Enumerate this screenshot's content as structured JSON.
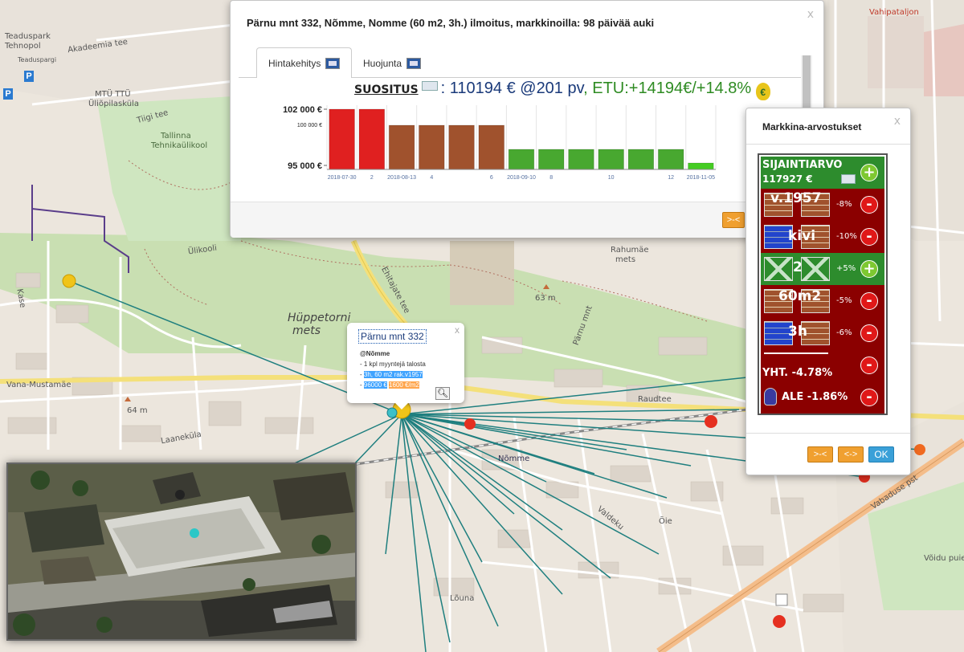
{
  "main_dialog": {
    "title": "Pärnu mnt 332, Nõmme, Nomme (60 m2, 3h.) ilmoitus, markkinoilla: 98 päivää auki",
    "close": "x",
    "tabs": [
      {
        "label": "Hintakehitys",
        "icon": "chart-icon"
      },
      {
        "label": "Huojunta",
        "icon": "chart-icon"
      }
    ],
    "recommendation": {
      "label": "SUOSITUS",
      "value": ": 110194 € @201 pv",
      "benefit": ", ETU:+14194€/+14.8%",
      "bag": "€"
    },
    "button_collapse": ">-<"
  },
  "chart_data": {
    "type": "bar",
    "title": "",
    "xlabel": "",
    "ylabel": "",
    "ylim": [
      94500,
      102500
    ],
    "y_ticks": [
      {
        "value": 102000,
        "label": "102 000 €",
        "major": true
      },
      {
        "value": 100000,
        "label": "100 000 €",
        "major": false
      },
      {
        "value": 95000,
        "label": "95 000 €",
        "major": true
      }
    ],
    "values": [
      102000,
      102000,
      100000,
      100000,
      100000,
      100000,
      97000,
      97000,
      97000,
      97000,
      97000,
      97000,
      96000
    ],
    "colors": [
      "#e02020",
      "#e02020",
      "#a0522d",
      "#a0522d",
      "#a0522d",
      "#a0522d",
      "#48a830",
      "#48a830",
      "#48a830",
      "#48a830",
      "#48a830",
      "#48a830",
      "#44cc22"
    ],
    "x_tick_labels": [
      "2018-07-30",
      "2",
      "2018-08-13",
      "4",
      "",
      "6",
      "2018-09-10",
      "8",
      "",
      "10",
      "",
      "12",
      "2018-11-05"
    ]
  },
  "side_dialog": {
    "title": "Markkina-arvostukset",
    "close": "x",
    "location": {
      "label": "SIJAINTIARVO",
      "value": "117927 €"
    },
    "rows": [
      {
        "text": "v.1957",
        "pct": "-8%",
        "sign": "-"
      },
      {
        "text": "kivi",
        "pct": "-10%",
        "sign": "-"
      },
      {
        "text": "2",
        "pct": "+5%",
        "sign": "+"
      },
      {
        "text": "60m2",
        "pct": "-5%",
        "sign": "-"
      },
      {
        "text": "3h",
        "pct": "-6%",
        "sign": "-"
      }
    ],
    "total": "YHT. -4.78%",
    "discount": "ALE -1.86%",
    "buttons": {
      "collapse": ">-<",
      "expand": "<->",
      "ok": "OK"
    }
  },
  "popup": {
    "title": "Pärnu mnt 332",
    "close": "x",
    "district": "@Nõmme",
    "line1": "- 1 kpl myyntejä talosta",
    "line2_prefix": "- ",
    "line2_highlight": "3h, 60 m2 rak.v1957",
    "line3_prefix": "- ",
    "line3_price": "96000 €",
    "line3_sqm": "1600 €/m2"
  },
  "map_labels": [
    {
      "text": "Teaduspark",
      "cls": ""
    },
    {
      "text": "Tehnopol",
      "cls": ""
    },
    {
      "text": "Teaduspargi",
      "cls": ""
    },
    {
      "text": "Akadeemia tee",
      "cls": ""
    },
    {
      "text": "MTÜ TTÜ",
      "cls": ""
    },
    {
      "text": "Üliõpilasküla",
      "cls": ""
    },
    {
      "text": "Tallinna",
      "cls": "park"
    },
    {
      "text": "Tehnikaülikool",
      "cls": "park"
    },
    {
      "text": "Tiigi tee",
      "cls": ""
    },
    {
      "text": "Ülikooli",
      "cls": ""
    },
    {
      "text": "Rahumäe",
      "cls": ""
    },
    {
      "text": "mets",
      "cls": ""
    },
    {
      "text": "Hüppetorni",
      "cls": "big"
    },
    {
      "text": "mets",
      "cls": "big"
    },
    {
      "text": "Ehitajate tee",
      "cls": ""
    },
    {
      "text": "63 m",
      "cls": ""
    },
    {
      "text": "64 m",
      "cls": ""
    },
    {
      "text": "Vana-Mustamäe",
      "cls": ""
    },
    {
      "text": "Laaneküla",
      "cls": ""
    },
    {
      "text": "Raudtee",
      "cls": ""
    },
    {
      "text": "Nõmme",
      "cls": ""
    },
    {
      "text": "Vabaduse pst",
      "cls": ""
    },
    {
      "text": "Võidu puiestee",
      "cls": ""
    },
    {
      "text": "Vahipataljon",
      "cls": "red"
    },
    {
      "text": "Valdeku",
      "cls": ""
    },
    {
      "text": "Õie",
      "cls": ""
    },
    {
      "text": "Pärnu mnt",
      "cls": ""
    },
    {
      "text": "Kase",
      "cls": ""
    },
    {
      "text": "Lõuna",
      "cls": ""
    }
  ]
}
